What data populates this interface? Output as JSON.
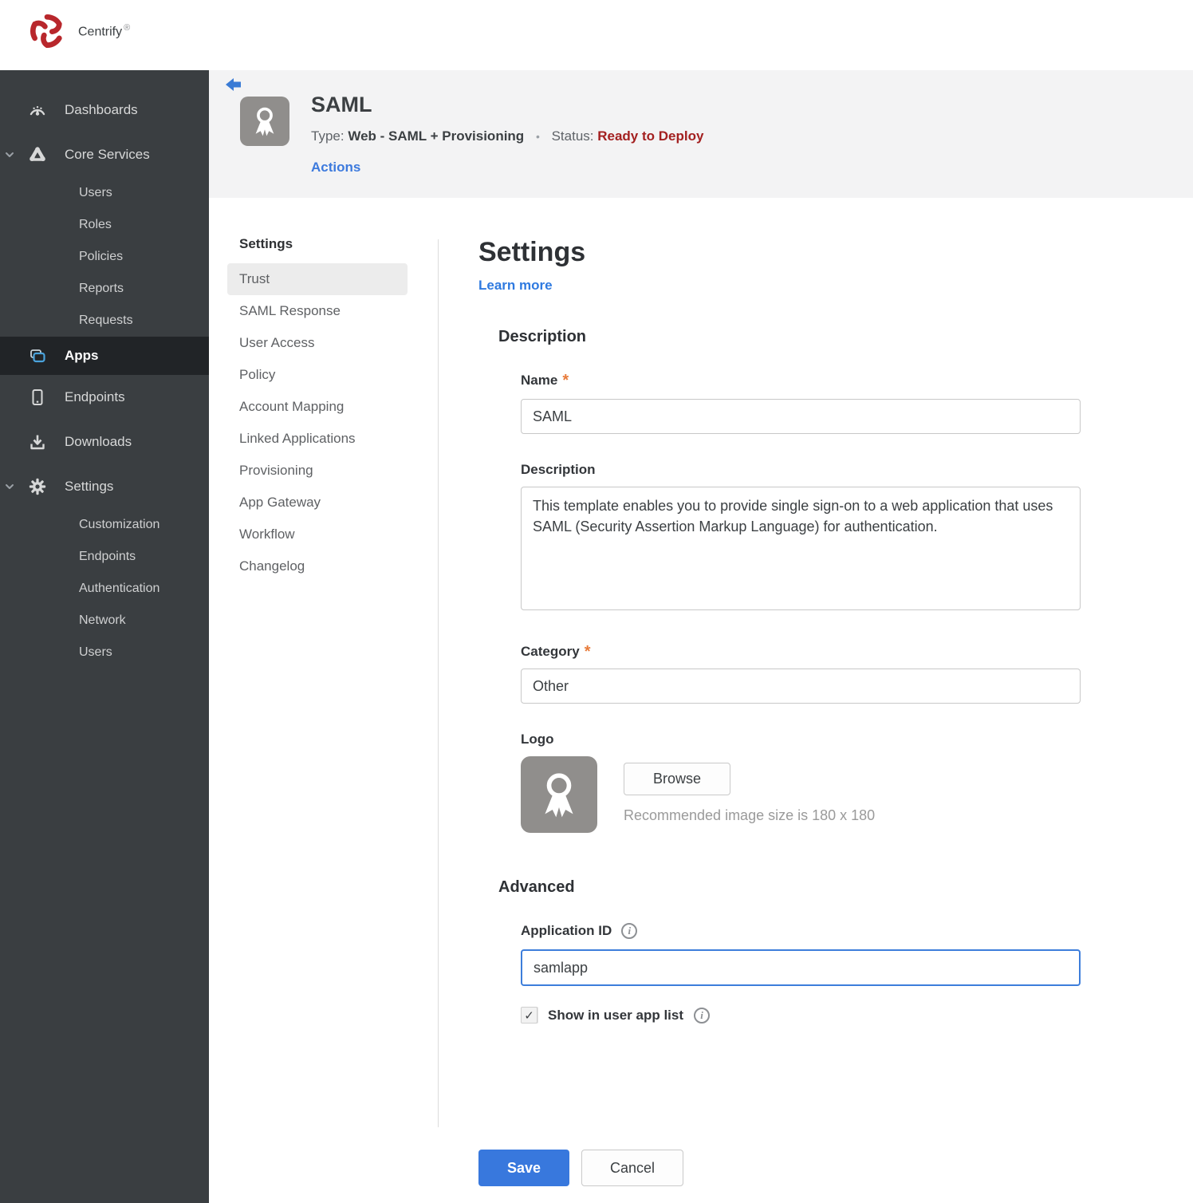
{
  "brand": {
    "name": "Centrify",
    "registered": "®"
  },
  "sidebar": {
    "items": [
      {
        "label": "Dashboards",
        "icon": "gauge-icon"
      },
      {
        "label": "Core Services",
        "icon": "core-services-icon",
        "expanded": true,
        "children": [
          "Users",
          "Roles",
          "Policies",
          "Reports",
          "Requests"
        ]
      },
      {
        "label": "Apps",
        "icon": "apps-icon",
        "active": true
      },
      {
        "label": "Endpoints",
        "icon": "tablet-icon"
      },
      {
        "label": "Downloads",
        "icon": "download-icon"
      },
      {
        "label": "Settings",
        "icon": "gear-icon",
        "expanded": true,
        "children": [
          "Customization",
          "Endpoints",
          "Authentication",
          "Network",
          "Users"
        ]
      }
    ]
  },
  "app_header": {
    "title": "SAML",
    "type_label": "Type:",
    "type_value": "Web - SAML + Provisioning",
    "separator": "•",
    "status_label": "Status:",
    "status_value": "Ready to Deploy",
    "actions_label": "Actions"
  },
  "subnav": {
    "header": "Settings",
    "active_item": "Trust",
    "items": [
      "Trust",
      "SAML Response",
      "User Access",
      "Policy",
      "Account Mapping",
      "Linked Applications",
      "Provisioning",
      "App Gateway",
      "Workflow",
      "Changelog"
    ]
  },
  "main": {
    "title": "Settings",
    "learn_more": "Learn more",
    "description_section": {
      "title": "Description",
      "name_label": "Name",
      "name_value": "SAML",
      "description_label": "Description",
      "description_value": "This template enables you to provide single sign-on to a web application that uses SAML (Security Assertion Markup Language) for authentication.",
      "category_label": "Category",
      "category_value": "Other",
      "logo_label": "Logo",
      "browse_label": "Browse",
      "logo_hint": "Recommended image size is 180 x 180"
    },
    "advanced_section": {
      "title": "Advanced",
      "application_id_label": "Application ID",
      "application_id_value": "samlapp",
      "show_in_user_app_list_label": "Show in user app list",
      "checkbox_checked": true
    },
    "save_label": "Save",
    "cancel_label": "Cancel"
  },
  "icons": {
    "check": "✓",
    "required": "*",
    "info": "i"
  },
  "colors": {
    "accent_blue": "#3878dd",
    "link_blue": "#2f7ae0",
    "status_red": "#a32020",
    "required_orange": "#e87b3a",
    "sidebar_bg": "#3a3e41",
    "sidebar_active_bg": "#212427",
    "header_band_bg": "#f3f3f4",
    "selected_item_bg": "#ececec",
    "brand_red": "#b8272c"
  }
}
